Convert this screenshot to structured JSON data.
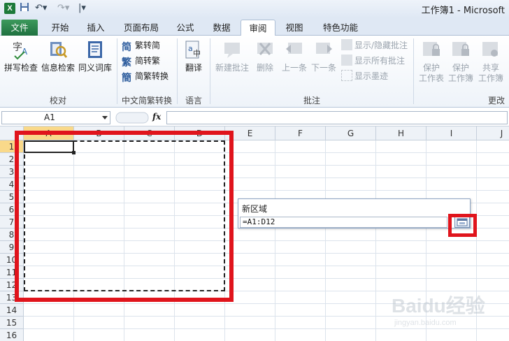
{
  "window": {
    "title": "工作簿1 - Microsoft",
    "logo_letter": "X"
  },
  "tabs": [
    "文件",
    "开始",
    "插入",
    "页面布局",
    "公式",
    "数据",
    "审阅",
    "视图",
    "特色功能"
  ],
  "ribbon": {
    "proofing": {
      "label": "校对",
      "spell_check": "拼写检查",
      "research": "信息检索",
      "thesaurus": "同义词库"
    },
    "chinese_conversion": {
      "label": "中文简繁转换",
      "to_simplified": "繁转简",
      "to_traditional": "简转繁",
      "convert": "简繁转换"
    },
    "language": {
      "label": "语言",
      "translate": "翻译"
    },
    "comments": {
      "label": "批注",
      "new": "新建批注",
      "delete": "删除",
      "previous": "上一条",
      "next": "下一条",
      "show_hide": "显示/隐藏批注",
      "show_all": "显示所有批注",
      "show_ink": "显示墨迹"
    },
    "changes": {
      "label": "更改",
      "protect_sheet_1": "保护",
      "protect_sheet_2": "工作表",
      "protect_book_1": "保护",
      "protect_book_2": "工作簿",
      "share_1": "共享",
      "share_2": "工作簿"
    }
  },
  "formula_bar": {
    "name_box": "A1",
    "fx": "fx",
    "formula": ""
  },
  "columns": [
    "A",
    "B",
    "C",
    "D",
    "E",
    "F",
    "G",
    "H",
    "I",
    "J"
  ],
  "rows": [
    "1",
    "2",
    "3",
    "4",
    "5",
    "6",
    "7",
    "8",
    "9",
    "10",
    "11",
    "12",
    "13",
    "14",
    "15",
    "16"
  ],
  "dialog": {
    "title": "新区域",
    "value": "=A1:D12"
  },
  "watermark": {
    "brand": "Baidu经验",
    "url": "jingyan.baidu.com"
  },
  "colors": {
    "annotation_red": "#e0141c",
    "file_tab": "#1f7140",
    "selected_header": "#f9d98a"
  }
}
